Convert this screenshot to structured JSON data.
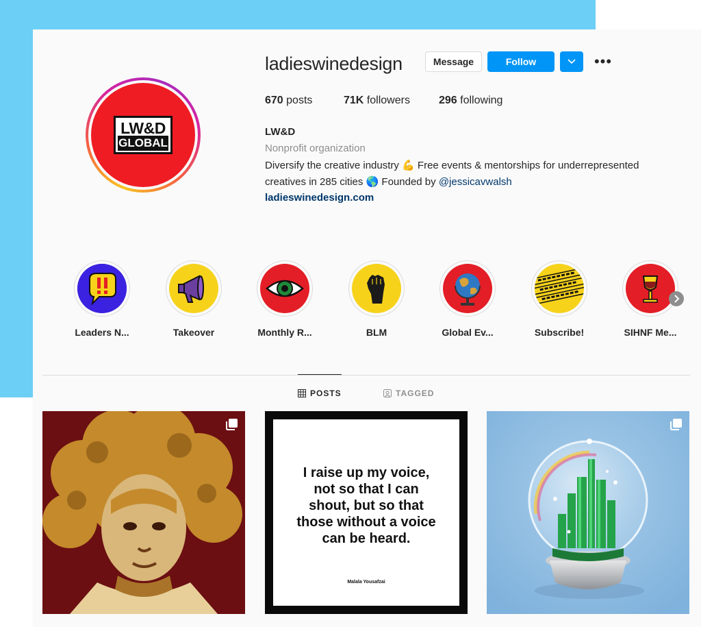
{
  "profile": {
    "username": "ladieswinedesign",
    "logo_line1": "LW&D",
    "logo_line2": "GLOBAL",
    "buttons": {
      "message": "Message",
      "follow": "Follow"
    },
    "stats": [
      {
        "value": "670",
        "label": "posts"
      },
      {
        "value": "71K",
        "label": "followers"
      },
      {
        "value": "296",
        "label": "following"
      }
    ],
    "bio": {
      "name": "LW&D",
      "category": "Nonprofit organization",
      "line1": "Diversify the creative industry 💪 Free events & mentorships for underrepresented",
      "line2_text": "creatives in 285 cities 🌎 Founded by ",
      "mention": "@jessicavwalsh",
      "link": "ladieswinedesign.com"
    }
  },
  "highlights": [
    {
      "label": "Leaders N...",
      "icon": "speech-bubble-exclamation-icon"
    },
    {
      "label": "Takeover",
      "icon": "megaphone-icon"
    },
    {
      "label": "Monthly R...",
      "icon": "eye-icon"
    },
    {
      "label": "BLM",
      "icon": "raised-fist-icon"
    },
    {
      "label": "Global Ev...",
      "icon": "globe-icon"
    },
    {
      "label": "Subscribe!",
      "icon": "subscribe-tape-icon"
    },
    {
      "label": "SIHNF Me...",
      "icon": "wine-glass-icon"
    }
  ],
  "tabs": [
    {
      "label": "POSTS",
      "icon": "grid-icon",
      "active": true
    },
    {
      "label": "TAGGED",
      "icon": "tagged-user-icon",
      "active": false
    }
  ],
  "posts": [
    {
      "kind": "illustration",
      "icon": "child-portrait-illustration"
    },
    {
      "kind": "quote",
      "quote_lines": [
        "I raise up my voice,",
        "not so that I can",
        "shout, but so that",
        "those without a voice",
        "can be heard."
      ],
      "author": "Malala Yousafzai"
    },
    {
      "kind": "illustration",
      "icon": "snow-globe-emerald-city-illustration"
    }
  ],
  "colors": {
    "background_blue": "#6ccff5",
    "follow_blue": "#0095f6",
    "logo_red": "#ef1c24",
    "link_navy": "#00376b"
  }
}
